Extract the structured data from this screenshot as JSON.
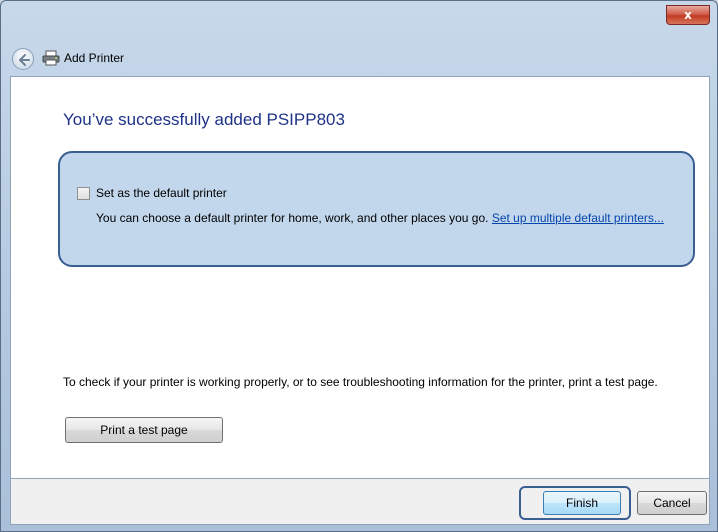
{
  "window": {
    "title": "Add Printer",
    "close_label": "x",
    "icons": [
      "back-arrow-icon",
      "printer-icon"
    ]
  },
  "main": {
    "heading": "You’ve successfully added PSIPP803",
    "default_printer": {
      "checkbox_label": "Set as the default printer",
      "checked": false,
      "description": "You can choose a default printer for home, work, and other places you go.",
      "link_text": "Set up multiple default printers..."
    },
    "test_info": "To check if your printer is working properly, or to see troubleshooting information for the printer, print a test page.",
    "test_button": "Print a test page"
  },
  "footer": {
    "finish": "Finish",
    "cancel": "Cancel"
  },
  "colors": {
    "heading": "#1e3287",
    "option_box_bg": "#c3d7ec",
    "option_box_border": "#3a5f93",
    "link": "#0645ad",
    "close_button": "#c23b22"
  }
}
